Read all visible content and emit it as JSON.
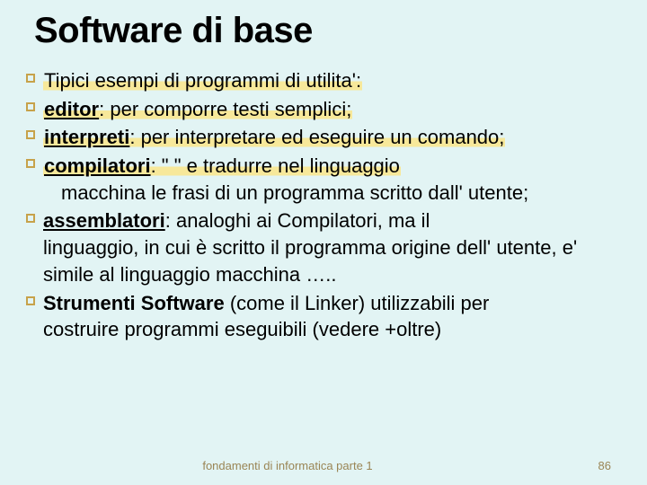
{
  "title": "Software di base",
  "items": {
    "b0": {
      "text": "Tipici esempi di programmi di utilita':"
    },
    "b1": {
      "term": "editor",
      "text": ": per comporre testi semplici;"
    },
    "b2": {
      "term": "interpreti",
      "text": ": per interpretare ed eseguire un comando;"
    },
    "b3": {
      "term": "compilatori",
      "text": ": \"    \"               e tradurre nel linguaggio",
      "cont": "macchina le frasi di un programma scritto dall' utente;"
    },
    "b4": {
      "term": "assemblatori",
      "text": ": analoghi ai Compilatori, ma il",
      "cont": "linguaggio, in cui è scritto il programma origine dell' utente, e' simile al linguaggio macchina ….."
    },
    "b5": {
      "term": "Strumenti Software",
      "text": " (come il Linker) utilizzabili per",
      "cont": "costruire programmi eseguibili (vedere +oltre)"
    }
  },
  "footer": {
    "text": "fondamenti di informatica parte 1",
    "page": "86"
  }
}
